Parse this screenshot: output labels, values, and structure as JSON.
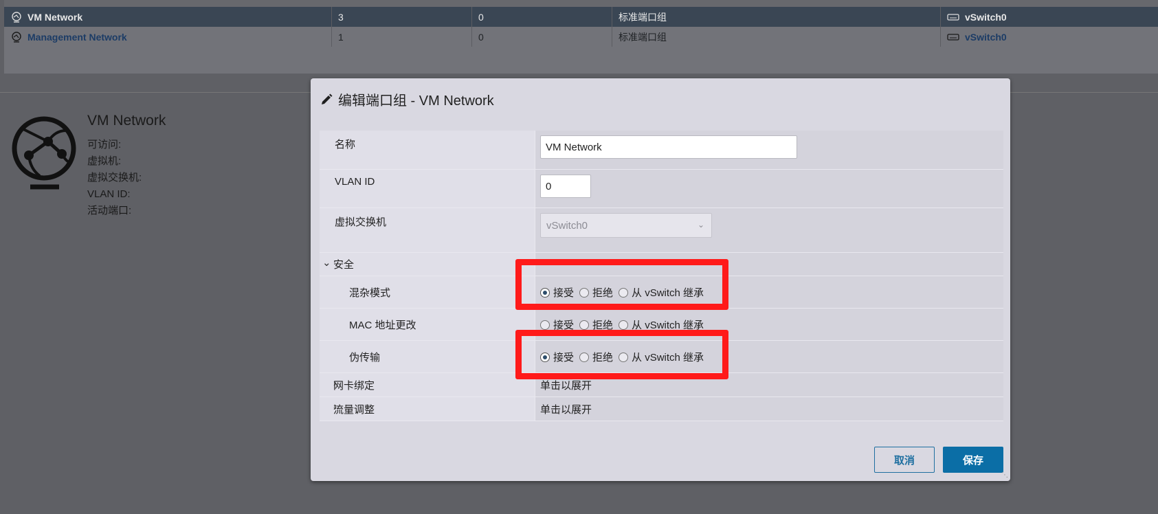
{
  "background": {
    "table_rows": [
      {
        "name": "VM Network",
        "vlan": "3",
        "ports": "0",
        "type": "标准端口组",
        "vswitch": "vSwitch0",
        "selected": true
      },
      {
        "name": "Management Network",
        "vlan": "1",
        "ports": "0",
        "type": "标准端口组",
        "vswitch": "vSwitch0",
        "selected": false
      }
    ],
    "detail": {
      "title": "VM Network",
      "labels": [
        "可访问:",
        "虚拟机:",
        "虚拟交换机:",
        "VLAN ID:",
        "活动端口:"
      ]
    }
  },
  "modal": {
    "title": "编辑端口组 - VM Network",
    "fields": {
      "name_label": "名称",
      "name_value": "VM Network",
      "vlan_label": "VLAN ID",
      "vlan_value": "0",
      "vswitch_label": "虚拟交换机",
      "vswitch_value": "vSwitch0"
    },
    "security": {
      "section_label": "安全",
      "rows": [
        {
          "label": "混杂模式",
          "selected": "accept"
        },
        {
          "label": "MAC 地址更改",
          "selected": "none"
        },
        {
          "label": "伪传输",
          "selected": "accept"
        }
      ],
      "options": {
        "accept": "接受",
        "reject": "拒绝",
        "inherit": "从 vSwitch 继承"
      }
    },
    "nic_teaming": {
      "label": "网卡绑定",
      "value": "单击以展开"
    },
    "traffic_shaping": {
      "label": "流量调整",
      "value": "单击以展开"
    },
    "buttons": {
      "cancel": "取消",
      "save": "保存"
    }
  },
  "colors": {
    "highlight": "#ff1a1a",
    "primary": "#0b6ea6"
  }
}
